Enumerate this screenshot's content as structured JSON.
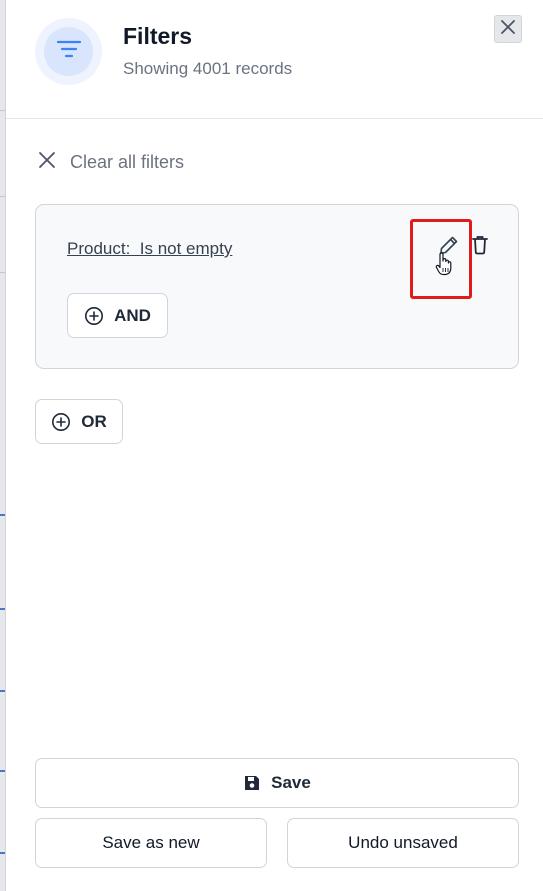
{
  "header": {
    "title": "Filters",
    "subtitle": "Showing 4001 records",
    "badge_icon": "filter-lines-icon",
    "close_icon": "close-icon"
  },
  "clear_filters": {
    "label": "Clear all filters",
    "icon": "x-icon"
  },
  "filter_group": {
    "condition_text": "Product:  Is not empty",
    "actions": [
      "pencil-icon",
      "trash-icon"
    ],
    "and_button": {
      "label": "AND",
      "icon": "plus-circle-icon"
    }
  },
  "or_button": {
    "label": "OR",
    "icon": "plus-circle-icon"
  },
  "footer": {
    "save_label": "Save",
    "save_icon": "floppy-disk-icon",
    "save_as_new_label": "Save as new",
    "undo_unsaved_label": "Undo unsaved"
  },
  "colors": {
    "accent_blue": "#3b82f6",
    "badge_outer": "#eef3fe",
    "badge_inner": "#d8e5fd",
    "highlight_red": "#e01b1b",
    "muted_text": "#6b7280"
  }
}
